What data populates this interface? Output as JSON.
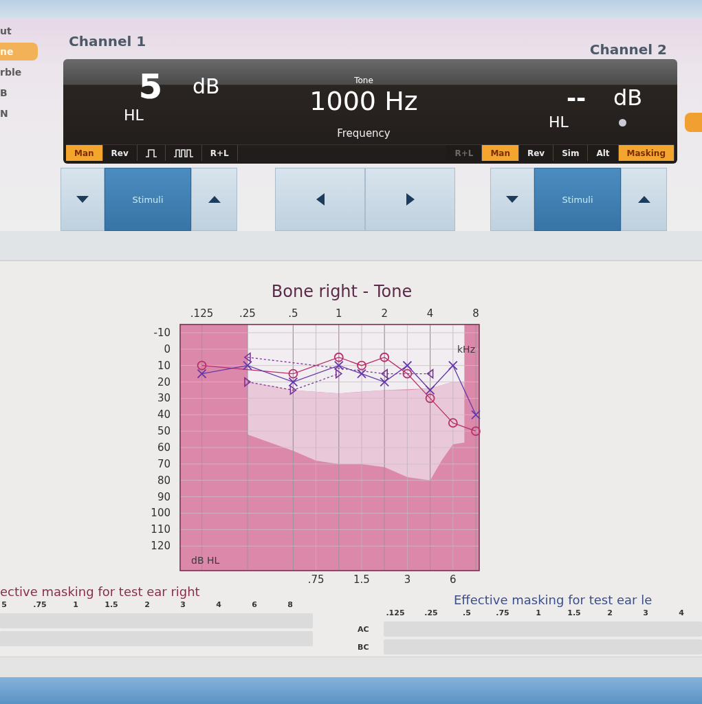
{
  "sidebar": {
    "items": [
      {
        "label": "ut",
        "selected": false
      },
      {
        "label": "ne",
        "selected": true
      },
      {
        "label": "rble",
        "selected": false
      },
      {
        "label": "B",
        "selected": false
      },
      {
        "label": "N",
        "selected": false
      }
    ]
  },
  "channel_1": {
    "title": "Channel 1",
    "value": "5",
    "unit": "dB",
    "scale": "HL",
    "modes": [
      {
        "kind": "text",
        "label": "Man",
        "selected": true
      },
      {
        "kind": "text",
        "label": "Rev",
        "selected": false
      },
      {
        "kind": "single-pulse",
        "selected": false
      },
      {
        "kind": "multi-pulse",
        "selected": false
      },
      {
        "kind": "text",
        "label": "R+L",
        "selected": false
      }
    ],
    "stimulus_button": "Stimuli"
  },
  "frequency": {
    "caption": "Tone",
    "value": "1000 Hz",
    "label": "Frequency"
  },
  "channel_2": {
    "title": "Channel 2",
    "value": "--",
    "unit": "dB",
    "scale": "HL",
    "modes": [
      {
        "kind": "text",
        "label": "R+L",
        "selected": false,
        "disabled": true
      },
      {
        "kind": "text",
        "label": "Man",
        "selected": true,
        "disabled": false
      },
      {
        "kind": "text",
        "label": "Rev",
        "selected": false,
        "disabled": false
      },
      {
        "kind": "text",
        "label": "Sim",
        "selected": false,
        "disabled": false
      },
      {
        "kind": "text",
        "label": "Alt",
        "selected": false,
        "disabled": false
      },
      {
        "kind": "text",
        "label": "Masking",
        "selected": true,
        "disabled": false
      }
    ],
    "stimulus_button": "Stimuli"
  },
  "audiogram": {
    "chart_data": {
      "type": "line",
      "title": "Bone right - Tone",
      "xlabel": "kHz",
      "ylabel": "dB HL",
      "categories": [
        ".125",
        null,
        ".25",
        null,
        ".5",
        ".75",
        "1",
        "1.5",
        "2",
        "3",
        "4",
        "6",
        "8"
      ],
      "series": [
        {
          "color": "#b8306a",
          "marker": "circle",
          "line_style": "solid",
          "values": [
            10,
            null,
            null,
            null,
            15,
            null,
            5,
            10,
            5,
            15,
            30,
            45,
            50
          ]
        },
        {
          "color": "#6438a8",
          "marker": "cross",
          "line_style": "solid",
          "values": [
            15,
            null,
            10,
            null,
            20,
            null,
            10,
            15,
            20,
            10,
            25,
            10,
            40
          ]
        },
        {
          "color": "#7a3296",
          "marker": "triangle",
          "line_style": "dashed",
          "values": [
            null,
            null,
            5,
            null,
            null,
            null,
            null,
            null,
            15,
            null,
            15,
            null,
            null
          ]
        },
        {
          "color": "#7a3296",
          "marker": "triangle",
          "line_style": "dashed",
          "values": [
            null,
            null,
            20,
            null,
            25,
            null,
            15,
            null,
            null,
            null,
            null,
            null,
            null
          ]
        }
      ],
      "ylim": [
        135,
        -15
      ],
      "yticks": [
        -10,
        0,
        10,
        20,
        30,
        40,
        50,
        60,
        70,
        80,
        90,
        100,
        110,
        120
      ],
      "grid": true
    }
  },
  "masking_right": {
    "title": "ective masking for test ear right",
    "frequencies": [
      "5",
      ".75",
      "1",
      "1.5",
      "2",
      "3",
      "4",
      "6",
      "8"
    ],
    "rows": [
      {
        "kind": "field"
      },
      {
        "kind": "field"
      }
    ]
  },
  "masking_left": {
    "title": "Effective masking for test ear le",
    "frequencies": [
      ".125",
      ".25",
      ".5",
      ".75",
      "1",
      "1.5",
      "2",
      "3",
      "4"
    ],
    "rows": [
      {
        "kind": "labeled",
        "label": "AC"
      },
      {
        "kind": "labeled",
        "label": "BC"
      }
    ]
  }
}
